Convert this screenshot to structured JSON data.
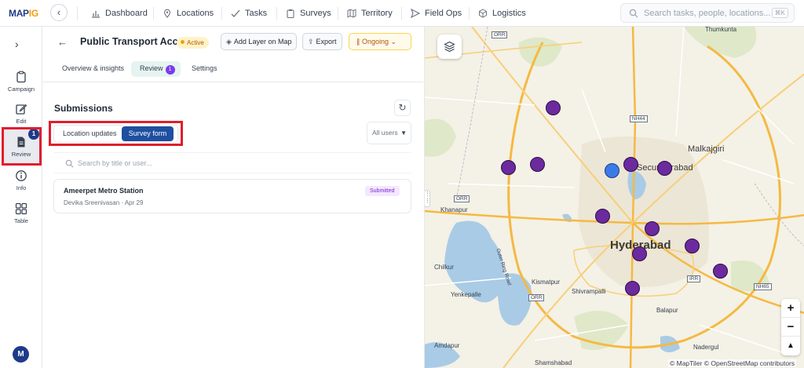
{
  "app": {
    "logo_main": "MAP",
    "logo_accent": "IG"
  },
  "topnav": {
    "items": [
      "Dashboard",
      "Locations",
      "Tasks",
      "Surveys",
      "Territory",
      "Field Ops",
      "Logistics"
    ],
    "search_placeholder": "Search tasks, people, locations...",
    "search_shortcut": "⌘K"
  },
  "rail": {
    "items": [
      {
        "label": "Campaign",
        "icon": "clipboard-icon"
      },
      {
        "label": "Edit",
        "icon": "edit-icon"
      },
      {
        "label": "Review",
        "icon": "document-icon",
        "badge": "1"
      },
      {
        "label": "Info",
        "icon": "info-icon"
      },
      {
        "label": "Table",
        "icon": "grid-icon"
      }
    ],
    "avatar_initial": "M"
  },
  "panel": {
    "title": "Public Transport Acc...",
    "status": "Active",
    "add_layer_label": "Add Layer on Map",
    "export_label": "Export",
    "ongoing_label": "Ongoing",
    "tabs": [
      {
        "label": "Overview & insights"
      },
      {
        "label": "Review",
        "badge": "1"
      },
      {
        "label": "Settings"
      }
    ],
    "submissions_title": "Submissions",
    "segments": {
      "a": "Location updates",
      "b": "Survey form",
      "active": "b"
    },
    "users_filter": "All users",
    "search_placeholder": "Search by title or user...",
    "submissions": [
      {
        "title": "Ameerpet Metro Station",
        "user": "Devika Sreenivasan",
        "date": "Apr 29",
        "status": "Submitted"
      }
    ]
  },
  "map": {
    "labels": {
      "thumkunta": "Thumkunta",
      "malkajgiri": "Malkajgiri",
      "secunderabad": "Secunderabad",
      "khanapur": "Khanapur",
      "hyderabad": "Hyderabad",
      "chilkur": "Chilkur",
      "kismatpur": "Kismatpur",
      "yenkepalle": "Yenkepalle",
      "shivrampalli": "Shivrampalli",
      "balapur": "Balapur",
      "amdapur": "Amdapur",
      "nadergul": "Nadergul",
      "shamshabad": "Shamshabad",
      "orr_road": "Outer Ring Road"
    },
    "shields": {
      "orr1": "ORR",
      "nh44": "NH44",
      "orr2": "ORR",
      "orr3": "ORR",
      "irr": "IRR",
      "nh65": "NH65"
    },
    "attribution": "© MapTiler © OpenStreetMap contributors",
    "marker_color": "#6b2a9e",
    "selected_marker_color": "#3b7be8",
    "zoom_in": "+",
    "zoom_out": "−"
  }
}
